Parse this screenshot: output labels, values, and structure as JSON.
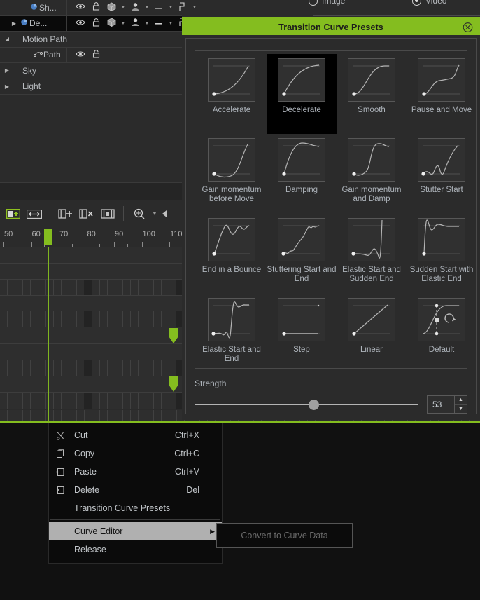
{
  "layer_tree": {
    "rows": [
      {
        "label": "Sh...",
        "arrow": "",
        "icon": "object-icon",
        "selected": false,
        "has_cols": true,
        "lock": "locked"
      },
      {
        "label": "De...",
        "arrow": "▶",
        "icon": "object-icon",
        "selected": true,
        "has_cols": true,
        "lock": "unlocked"
      },
      {
        "label": "Motion Path",
        "arrow": "◢",
        "icon": "",
        "selected": false,
        "has_cols": false,
        "lock": ""
      },
      {
        "label": "Path",
        "arrow": "",
        "icon": "path-icon",
        "selected": false,
        "has_cols": true,
        "lock": "unlocked",
        "minimal": true
      },
      {
        "label": "Sky",
        "arrow": "▶",
        "icon": "",
        "selected": false,
        "has_cols": false,
        "lock": ""
      },
      {
        "label": "Light",
        "arrow": "▶",
        "icon": "",
        "selected": false,
        "has_cols": false,
        "lock": ""
      }
    ]
  },
  "top_right": {
    "image_label": "Image",
    "video_label": "Video",
    "selected": "Video"
  },
  "timeline": {
    "toolbar_icons": [
      "add-track-icon",
      "fit-width-icon",
      "insert-frame-icon",
      "delete-frame-icon",
      "split-frame-icon",
      "zoom-icon"
    ],
    "ruler_ticks": [
      "50",
      "60",
      "70",
      "80",
      "90",
      "100",
      "110"
    ],
    "playhead_frame": "65"
  },
  "dialog": {
    "title": "Transition Curve Presets",
    "close_icon": "close-circle-icon",
    "selected_preset": "Decelerate",
    "presets": [
      {
        "label": "Accelerate",
        "curve": "accelerate"
      },
      {
        "label": "Decelerate",
        "curve": "decelerate"
      },
      {
        "label": "Smooth",
        "curve": "smooth"
      },
      {
        "label": "Pause and Move",
        "curve": "pause_and_move"
      },
      {
        "label": "Gain momentum before Move",
        "curve": "gain_momentum_before_move"
      },
      {
        "label": "Damping",
        "curve": "damping"
      },
      {
        "label": "Gain momentum and Damp",
        "curve": "gain_momentum_and_damp"
      },
      {
        "label": "Stutter Start",
        "curve": "stutter_start"
      },
      {
        "label": "End in a Bounce",
        "curve": "end_in_a_bounce"
      },
      {
        "label": "Stuttering Start and End",
        "curve": "stuttering_start_and_end"
      },
      {
        "label": "Elastic Start and Sudden End",
        "curve": "elastic_start_and_sudden_end"
      },
      {
        "label": "Sudden Start with Elastic End",
        "curve": "sudden_start_with_elastic_end"
      },
      {
        "label": "Elastic Start and End",
        "curve": "elastic_start_and_end"
      },
      {
        "label": "Step",
        "curve": "step"
      },
      {
        "label": "Linear",
        "curve": "linear"
      },
      {
        "label": "Default",
        "curve": "default"
      }
    ],
    "strength": {
      "label": "Strength",
      "value": "53",
      "min": 0,
      "max": 100,
      "percent": 53
    },
    "accent_color": "#84bd1f"
  },
  "context_menu": {
    "items": [
      {
        "label": "Cut",
        "shortcut": "Ctrl+X",
        "icon": "cut-icon",
        "highlight": false,
        "submenu": false
      },
      {
        "label": "Copy",
        "shortcut": "Ctrl+C",
        "icon": "copy-icon",
        "highlight": false,
        "submenu": false
      },
      {
        "label": "Paste",
        "shortcut": "Ctrl+V",
        "icon": "paste-icon",
        "highlight": false,
        "submenu": false
      },
      {
        "label": "Delete",
        "shortcut": "Del",
        "icon": "delete-icon",
        "highlight": false,
        "submenu": false
      },
      {
        "label": "Transition Curve Presets",
        "shortcut": "",
        "icon": "",
        "highlight": false,
        "submenu": false
      },
      {
        "label": "Curve Editor",
        "shortcut": "",
        "icon": "",
        "highlight": true,
        "submenu": true
      },
      {
        "label": "Release",
        "shortcut": "",
        "icon": "",
        "highlight": false,
        "submenu": false
      }
    ],
    "submenu": {
      "label": "Convert to Curve Data",
      "disabled": true
    }
  }
}
